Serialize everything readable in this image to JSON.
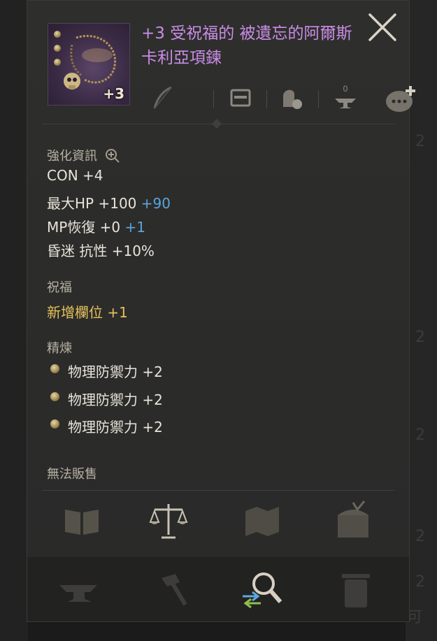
{
  "item": {
    "title": "+3 受祝福的 被遺忘的阿爾斯卡利亞項鍊",
    "enhance_level": "+3",
    "sockets": 3,
    "rarity_color": "#c98de6"
  },
  "actions": [
    "bow-icon",
    "card-icon",
    "seal-bag-icon",
    "anvil-icon",
    "chat-add-icon"
  ],
  "stats_section": {
    "label": "強化資訊",
    "lines": [
      {
        "text": "CON +4",
        "bonus": ""
      },
      {
        "text": "最大HP +100",
        "bonus": "+90"
      },
      {
        "text": "MP恢復 +0",
        "bonus": "+1"
      },
      {
        "text": "昏迷 抗性 +10%",
        "bonus": ""
      }
    ]
  },
  "blessing_section": {
    "label": "祝福",
    "line_text": "新增欄位",
    "line_bonus": "+1"
  },
  "refine_section": {
    "label": "精煉",
    "lines": [
      "物理防禦力 +2",
      "物理防禦力 +2",
      "物理防禦力 +2"
    ]
  },
  "footer": {
    "unsellable": "無法販售"
  },
  "tools": [
    "book-icon",
    "scales-icon",
    "map-icon",
    "chest-icon"
  ],
  "bottom_tools": [
    "anvil-icon",
    "hammer-icon",
    "magnifier-swap-icon",
    "trash-icon"
  ],
  "colors": {
    "bonus_blue": "#59a5dc",
    "gold": "#e6c15b",
    "text": "#e8e4da"
  },
  "background_glyphs": [
    "2",
    "2",
    "2",
    "2",
    "2",
    "可"
  ]
}
